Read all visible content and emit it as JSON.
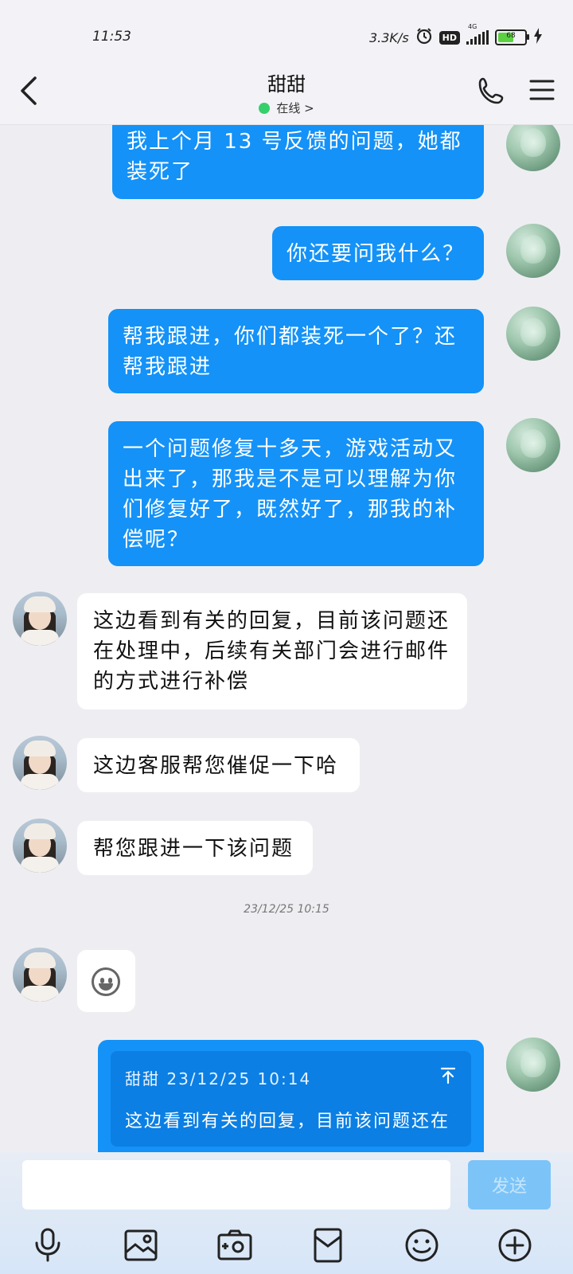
{
  "status_bar": {
    "time": "11:53",
    "net_speed": "3.3K/s",
    "hd_label": "HD",
    "signal_label": "4G",
    "battery_level": 68,
    "battery_text": "68"
  },
  "header": {
    "contact_name": "甜甜",
    "online_status": "在线 >"
  },
  "messages": {
    "m1": "我上个月 13 号反馈的问题，她都装死了",
    "m2": "你还要问我什么？",
    "m3": "帮我跟进，你们都装死一个了？还帮我跟进",
    "m4": "一个问题修复十多天，游戏活动又出来了，那我是不是可以理解为你们修复好了，既然好了，那我的补偿呢？",
    "r1": "这边看到有关的回复，目前该问题还在处理中，后续有关部门会进行邮件的方式进行补偿",
    "r2": "这边客服帮您催促一下哈",
    "r3": "帮您跟进一下该问题",
    "timestamp": "23/12/25 10:15",
    "quote_sender": "甜甜 23/12/25 10:14",
    "quote_text": "这边看到有关的回复，目前该问题还在"
  },
  "input": {
    "value": "",
    "placeholder": "",
    "send_label": "发送"
  },
  "toolbar": {
    "icons": [
      "microphone-icon",
      "image-icon",
      "camera-icon",
      "red-packet-icon",
      "emoji-icon",
      "plus-icon"
    ]
  },
  "colors": {
    "my_bubble": "#1492f7",
    "their_bubble": "#ffffff",
    "online_dot": "#35d06b",
    "send_button": "#7cc4f8"
  }
}
